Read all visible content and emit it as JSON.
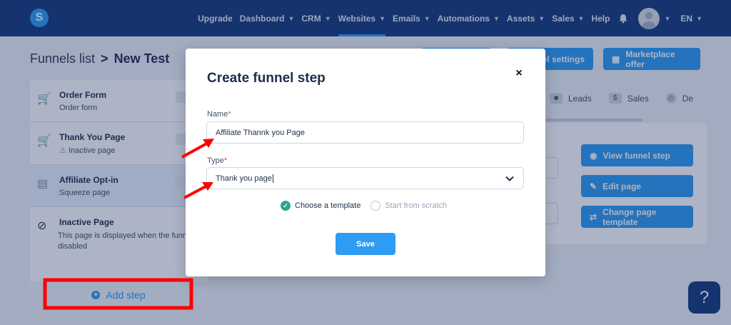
{
  "nav": {
    "logo": "S",
    "items": [
      {
        "label": "Upgrade",
        "chevron": false
      },
      {
        "label": "Dashboard",
        "chevron": true
      },
      {
        "label": "CRM",
        "chevron": true
      },
      {
        "label": "Websites",
        "chevron": true,
        "active": true
      },
      {
        "label": "Emails",
        "chevron": true
      },
      {
        "label": "Automations",
        "chevron": true
      },
      {
        "label": "Assets",
        "chevron": true
      },
      {
        "label": "Sales",
        "chevron": true
      },
      {
        "label": "Help",
        "chevron": false
      }
    ],
    "language": "EN",
    "icons": [
      "bell-icon",
      "avatar-icon"
    ]
  },
  "breadcrumb": {
    "parent": "Funnels list",
    "separator": ">",
    "current": "New Test"
  },
  "header_buttons": {
    "settings": "nel settings",
    "marketplace": "Marketplace offer"
  },
  "steps": [
    {
      "title": "Order Form",
      "subtitle": "Order form",
      "icon": "cart-icon"
    },
    {
      "title": "Thank You Page",
      "subtitle": "Inactive page",
      "icon": "cart-check-icon",
      "warning": true
    },
    {
      "title": "Affiliate Opt-in",
      "subtitle": "Squeeze page",
      "icon": "form-icon",
      "selected": true
    },
    {
      "title": "Inactive Page",
      "subtitle": "This page is displayed when the funnel disabled",
      "icon": "ban-icon"
    }
  ],
  "add_step_label": "Add step",
  "tabs": [
    {
      "label": "Leads",
      "icon": "users-icon"
    },
    {
      "label": "Sales",
      "icon": "dollar-icon"
    },
    {
      "label": "De",
      "icon": "clock-icon"
    }
  ],
  "side_buttons": {
    "view": "View funnel step",
    "edit": "Edit page",
    "change": "Change page template"
  },
  "help_label": "?",
  "modal": {
    "title": "Create funnel step",
    "close": "×",
    "name_label": "Name",
    "name_value": "Affiliate Thannk you Page",
    "type_label": "Type",
    "type_value": "Thank you page",
    "required_mark": "*",
    "option_template": "Choose a template",
    "option_scratch": "Start from scratch",
    "selected_option": "Choose a template",
    "save_label": "Save"
  },
  "colors": {
    "nav_bg": "#163a7a",
    "accent": "#2d9cf2",
    "success": "#2ca58d",
    "annotation": "#ff0000"
  }
}
